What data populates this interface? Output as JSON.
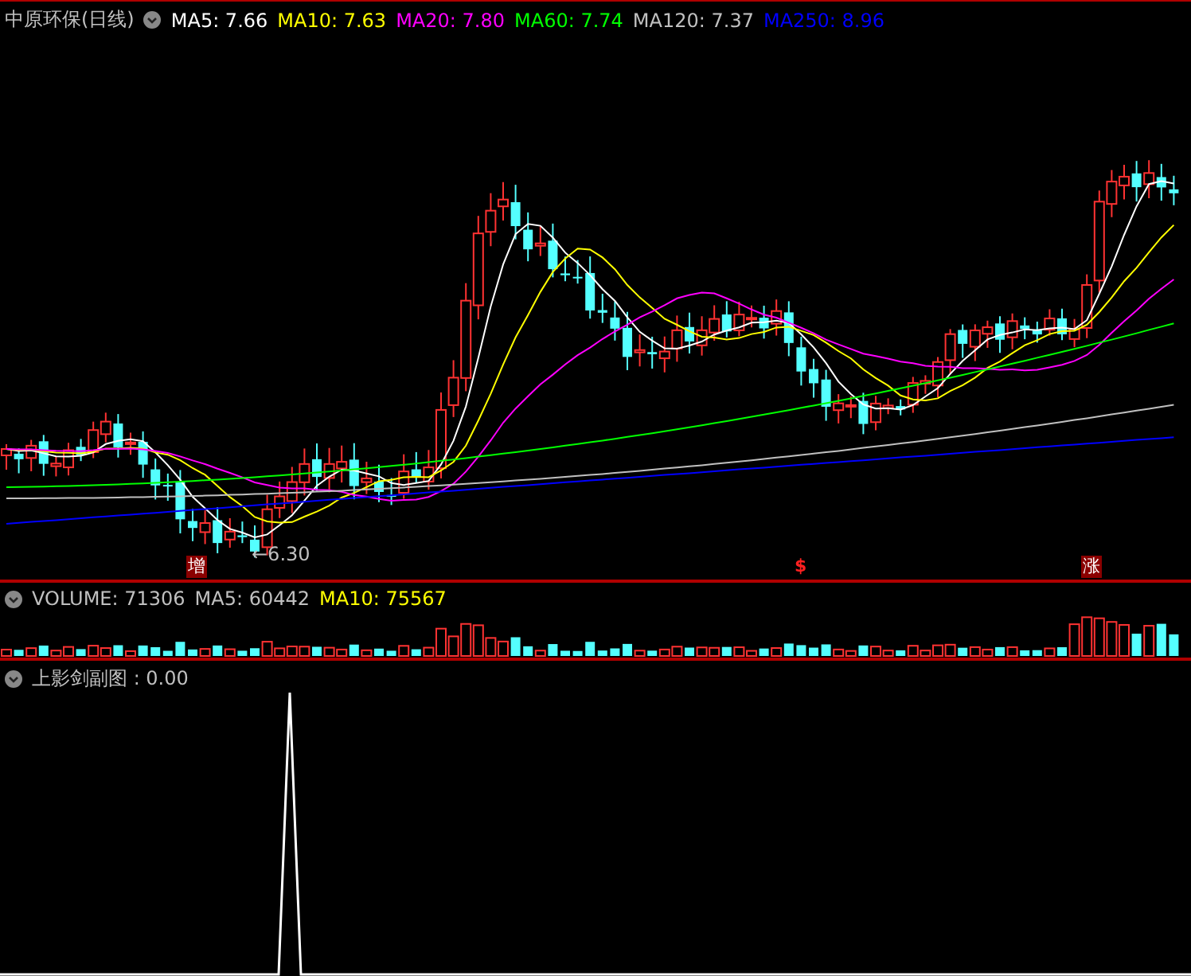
{
  "main_panel": {
    "title": "中原环保(日线)",
    "indicators": [
      {
        "label": "MA5: 7.66",
        "color": "#ffffff"
      },
      {
        "label": "MA10: 7.63",
        "color": "#ffff00"
      },
      {
        "label": "MA20: 7.80",
        "color": "#ff00ff"
      },
      {
        "label": "MA60: 7.74",
        "color": "#00ff00"
      },
      {
        "label": "MA120: 7.37",
        "color": "#c0c0c0"
      },
      {
        "label": "MA250: 8.96",
        "color": "#0000ff"
      }
    ],
    "low_price_label": "←6.30",
    "markers": [
      {
        "text": "增",
        "kind": "boxed"
      },
      {
        "text": "$",
        "kind": "plain"
      },
      {
        "text": "涨",
        "kind": "boxed"
      }
    ]
  },
  "volume_panel": {
    "indicators": [
      {
        "label": "VOLUME: 71306",
        "color": "#c0c0c0"
      },
      {
        "label": "MA5: 60442",
        "color": "#c0c0c0"
      },
      {
        "label": "MA10: 75567",
        "color": "#ffff00"
      }
    ]
  },
  "sub_panel": {
    "title": "上影剑副图 : 0.00"
  }
}
